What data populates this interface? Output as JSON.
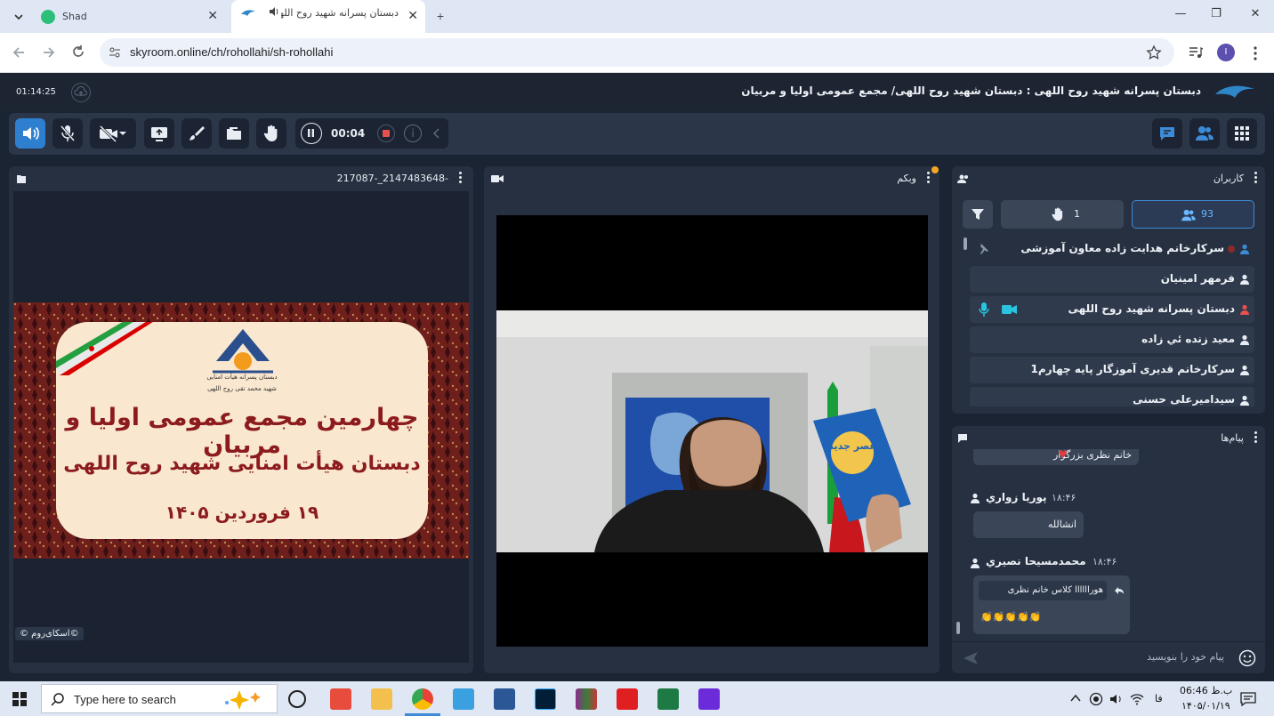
{
  "browser": {
    "tabs": [
      {
        "label": "Shad"
      },
      {
        "label": "دبستان پسرانه شهید روح اللهی"
      }
    ],
    "url": "skyroom.online/ch/rohollahi/sh-rohollahi",
    "profile_initial": "I"
  },
  "header": {
    "timer": "01:14:25",
    "title": "دبستان پسرانه شهید روح اللهی : دبستان شهید روح اللهی/ مجمع عمومی اولیا و مربیان"
  },
  "toolbar": {
    "record_time": "00:04"
  },
  "share_panel": {
    "title": "217087-_2147483648-",
    "watermark": "©اسکای‌روم ©",
    "banner": {
      "school_line1": "دبستان پسرانه هیأت امنایی",
      "school_line2": "شهید محمد تقی روح اللهی",
      "headline": "چهارمین مجمع عمومی اولیا و مربیان",
      "subheadline": "دبستان هیأت امنایی شهید روح اللهی",
      "date": "۱۹ فروردین ۱۴۰۵"
    }
  },
  "webcam_panel": {
    "title": "وبکم",
    "book_text": "عصر جدید"
  },
  "users_panel": {
    "title": "کاربران",
    "total_count": "93",
    "hands_count": "1",
    "users": [
      {
        "name": "سرکارخانم هدایت زاده معاون آموزشی"
      },
      {
        "name": "فرمهر امینیان"
      },
      {
        "name": "دبستان پسرانه شهید روح اللهی"
      },
      {
        "name": "معید زنده ئي زاده"
      },
      {
        "name": "سرکارخانم قدیری آموزگار پایه چهارم1"
      },
      {
        "name": "سیدامیرعلی حسنی"
      }
    ]
  },
  "chat_panel": {
    "title": "پیام‌ها",
    "messages": [
      {
        "text": "خانم نظری بزرگوار"
      },
      {
        "sender": "پوريا زواري",
        "time": "۱۸:۴۶",
        "text": "انشالله"
      },
      {
        "sender": "محمدمسيحا نصيري",
        "time": "۱۸:۴۶",
        "text": "هوراااااا کلاس خانم نظری",
        "text2": "👏👏👏👏👏"
      }
    ],
    "input_placeholder": "پیام خود را بنویسید"
  },
  "taskbar": {
    "search_placeholder": "Type here to search",
    "time": "06:46 ب.ظ",
    "lang": "فا",
    "date": "۱۴۰۵/۰۱/۱۹"
  },
  "colors": {
    "accent": "#3d8bd6",
    "panel": "#263041",
    "background": "#1a2433",
    "banner_red": "#8c1b1e"
  }
}
